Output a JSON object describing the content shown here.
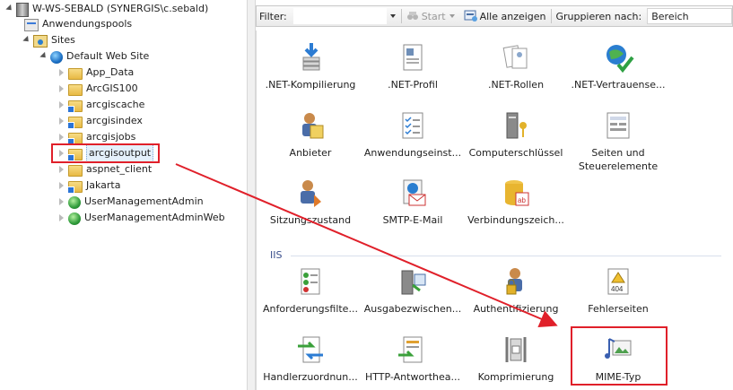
{
  "tree": {
    "nodes": [
      {
        "label": "W-WS-SEBALD (SYNERGIS\\c.sebald)",
        "icon": "server-icon"
      },
      {
        "label": "Anwendungspools",
        "icon": "app-pool-icon"
      },
      {
        "label": "Sites",
        "icon": "sites-folder-icon"
      },
      {
        "label": "Default Web Site",
        "icon": "globe-icon"
      },
      {
        "label": "App_Data",
        "icon": "folder-icon"
      },
      {
        "label": "ArcGIS100",
        "icon": "folder-icon"
      },
      {
        "label": "arcgiscache",
        "icon": "app-folder-icon"
      },
      {
        "label": "arcgisindex",
        "icon": "app-folder-icon"
      },
      {
        "label": "arcgisjobs",
        "icon": "app-folder-icon"
      },
      {
        "label": "arcgisoutput",
        "icon": "app-folder-icon"
      },
      {
        "label": "aspnet_client",
        "icon": "folder-icon"
      },
      {
        "label": "Jakarta",
        "icon": "app-folder-icon"
      },
      {
        "label": "UserManagementAdmin",
        "icon": "globe-icon"
      },
      {
        "label": "UserManagementAdminWeb",
        "icon": "globe-icon"
      }
    ]
  },
  "toolbar": {
    "filter_label": "Filter:",
    "start_label": "Start",
    "show_all_label": "Alle anzeigen",
    "group_by_label": "Gruppieren nach:",
    "group_by_value": "Bereich"
  },
  "sections": {
    "iis_title": "IIS"
  },
  "features": {
    "aspnet": [
      {
        "label": ".NET-Kompilierung",
        "icon": "net-compilation-icon"
      },
      {
        "label": ".NET-Profil",
        "icon": "net-profile-icon"
      },
      {
        "label": ".NET-Rollen",
        "icon": "net-roles-icon"
      },
      {
        "label": ".NET-Vertrauense...",
        "icon": "net-trust-icon"
      },
      {
        "label": "Anbieter",
        "icon": "providers-icon"
      },
      {
        "label": "Anwendungseinst...",
        "icon": "app-settings-icon"
      },
      {
        "label": "Computerschlüssel",
        "icon": "machine-key-icon"
      },
      {
        "label": "Seiten und Steuerelemente",
        "icon": "pages-controls-icon"
      },
      {
        "label": "Sitzungszustand",
        "icon": "session-state-icon"
      },
      {
        "label": "SMTP-E-Mail",
        "icon": "smtp-email-icon"
      },
      {
        "label": "Verbindungszeich...",
        "icon": "connection-strings-icon"
      }
    ],
    "iis": [
      {
        "label": "Anforderungsfilte...",
        "icon": "request-filtering-icon"
      },
      {
        "label": "Ausgabezwischen...",
        "icon": "output-caching-icon"
      },
      {
        "label": "Authentifizierung",
        "icon": "authentication-icon"
      },
      {
        "label": "Fehlerseiten",
        "icon": "error-pages-icon"
      },
      {
        "label": "Handlerzuordnun...",
        "icon": "handler-mappings-icon"
      },
      {
        "label": "HTTP-Antworthea...",
        "icon": "http-headers-icon"
      },
      {
        "label": "Komprimierung",
        "icon": "compression-icon"
      },
      {
        "label": "MIME-Typ",
        "icon": "mime-types-icon"
      }
    ]
  },
  "colors": {
    "annotation": "#e0202a",
    "section_header": "#3a4f8c"
  }
}
